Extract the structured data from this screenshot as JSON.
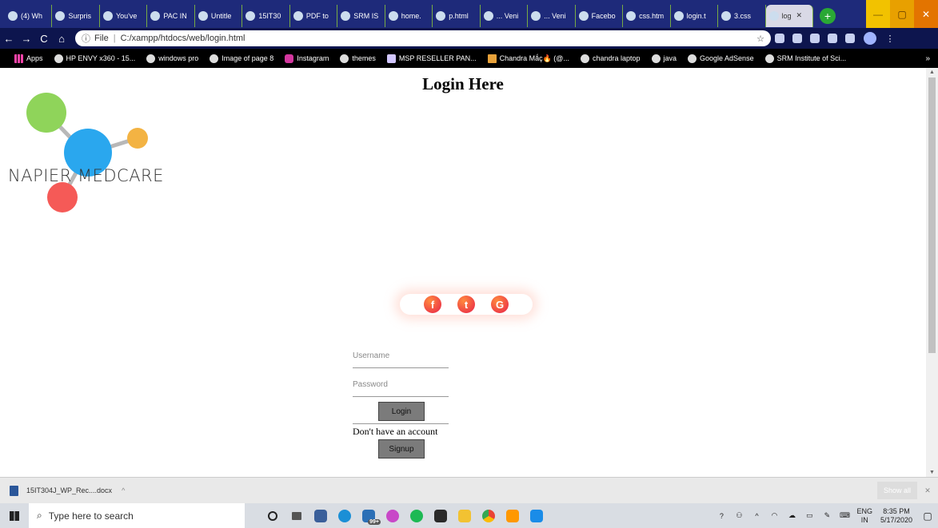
{
  "browser": {
    "tabs": [
      {
        "label": "(4) Wh"
      },
      {
        "label": "Surpris"
      },
      {
        "label": "You've"
      },
      {
        "label": "PAC IN"
      },
      {
        "label": "Untitle"
      },
      {
        "label": "15IT30"
      },
      {
        "label": "PDF to"
      },
      {
        "label": "SRM IS"
      },
      {
        "label": "home."
      },
      {
        "label": "p.html"
      },
      {
        "label": "... Veni"
      },
      {
        "label": "... Veni"
      },
      {
        "label": "Facebo"
      },
      {
        "label": "css.htm"
      },
      {
        "label": "login.t"
      },
      {
        "label": "3.css"
      },
      {
        "label": "log"
      }
    ],
    "new_tab": "+",
    "window": {
      "minimize": "—",
      "maximize": "▢",
      "close": "✕"
    },
    "nav": {
      "back": "←",
      "forward": "→",
      "reload": "C",
      "home": "⌂"
    },
    "address": {
      "scheme_label": "File",
      "separator": "|",
      "url": "C:/xampp/htdocs/web/login.html",
      "star": "☆"
    },
    "bookmarks": [
      {
        "label": "Apps",
        "icon": "apps-grid-icon"
      },
      {
        "label": "HP ENVY x360 - 15...",
        "icon": "globe-icon"
      },
      {
        "label": "windows pro",
        "icon": "globe-icon"
      },
      {
        "label": "Image of page 8",
        "icon": "globe-icon"
      },
      {
        "label": "Instagram",
        "icon": "instagram-icon"
      },
      {
        "label": "themes",
        "icon": "globe-icon"
      },
      {
        "label": "MSP RESELLER PAN...",
        "icon": "shield-icon"
      },
      {
        "label": "Chandra Mắç🔥 (@...",
        "icon": "bookmark-icon"
      },
      {
        "label": "chandra laptop",
        "icon": "globe-icon"
      },
      {
        "label": "java",
        "icon": "globe-icon"
      },
      {
        "label": "Google AdSense",
        "icon": "globe-icon"
      },
      {
        "label": "SRM Institute of Sci...",
        "icon": "globe-icon"
      }
    ],
    "bookmarks_more": "»"
  },
  "page": {
    "heading": "Login Here",
    "logo_text": "NAPIER MEDCARE",
    "social": [
      {
        "glyph": "f",
        "icon": "facebook-icon"
      },
      {
        "glyph": "t",
        "icon": "twitter-icon"
      },
      {
        "glyph": "G",
        "icon": "google-icon"
      }
    ],
    "form": {
      "username_placeholder": "Username",
      "password_placeholder": "Password",
      "login_label": "Login",
      "no_account_text": "Don't have an account",
      "signup_label": "Signup"
    }
  },
  "downloads": {
    "file_name": "15IT304J_WP_Rec....docx",
    "caret": "^",
    "show_all": "Show all",
    "close": "✕"
  },
  "taskbar": {
    "search_placeholder": "Type here to search",
    "language": "ENG",
    "region": "IN",
    "time": "8:35 PM",
    "date": "5/17/2020",
    "badge": "99+"
  },
  "colors": {
    "tab_strip": "#1e2a7a",
    "toolbar": "#0d154e",
    "bookmarks_bar": "#000000",
    "button_gray": "#7b7b7b",
    "logo_green": "#8fd45a",
    "logo_blue": "#2aa7ee",
    "logo_orange": "#f3b343",
    "logo_red": "#f55a57"
  }
}
